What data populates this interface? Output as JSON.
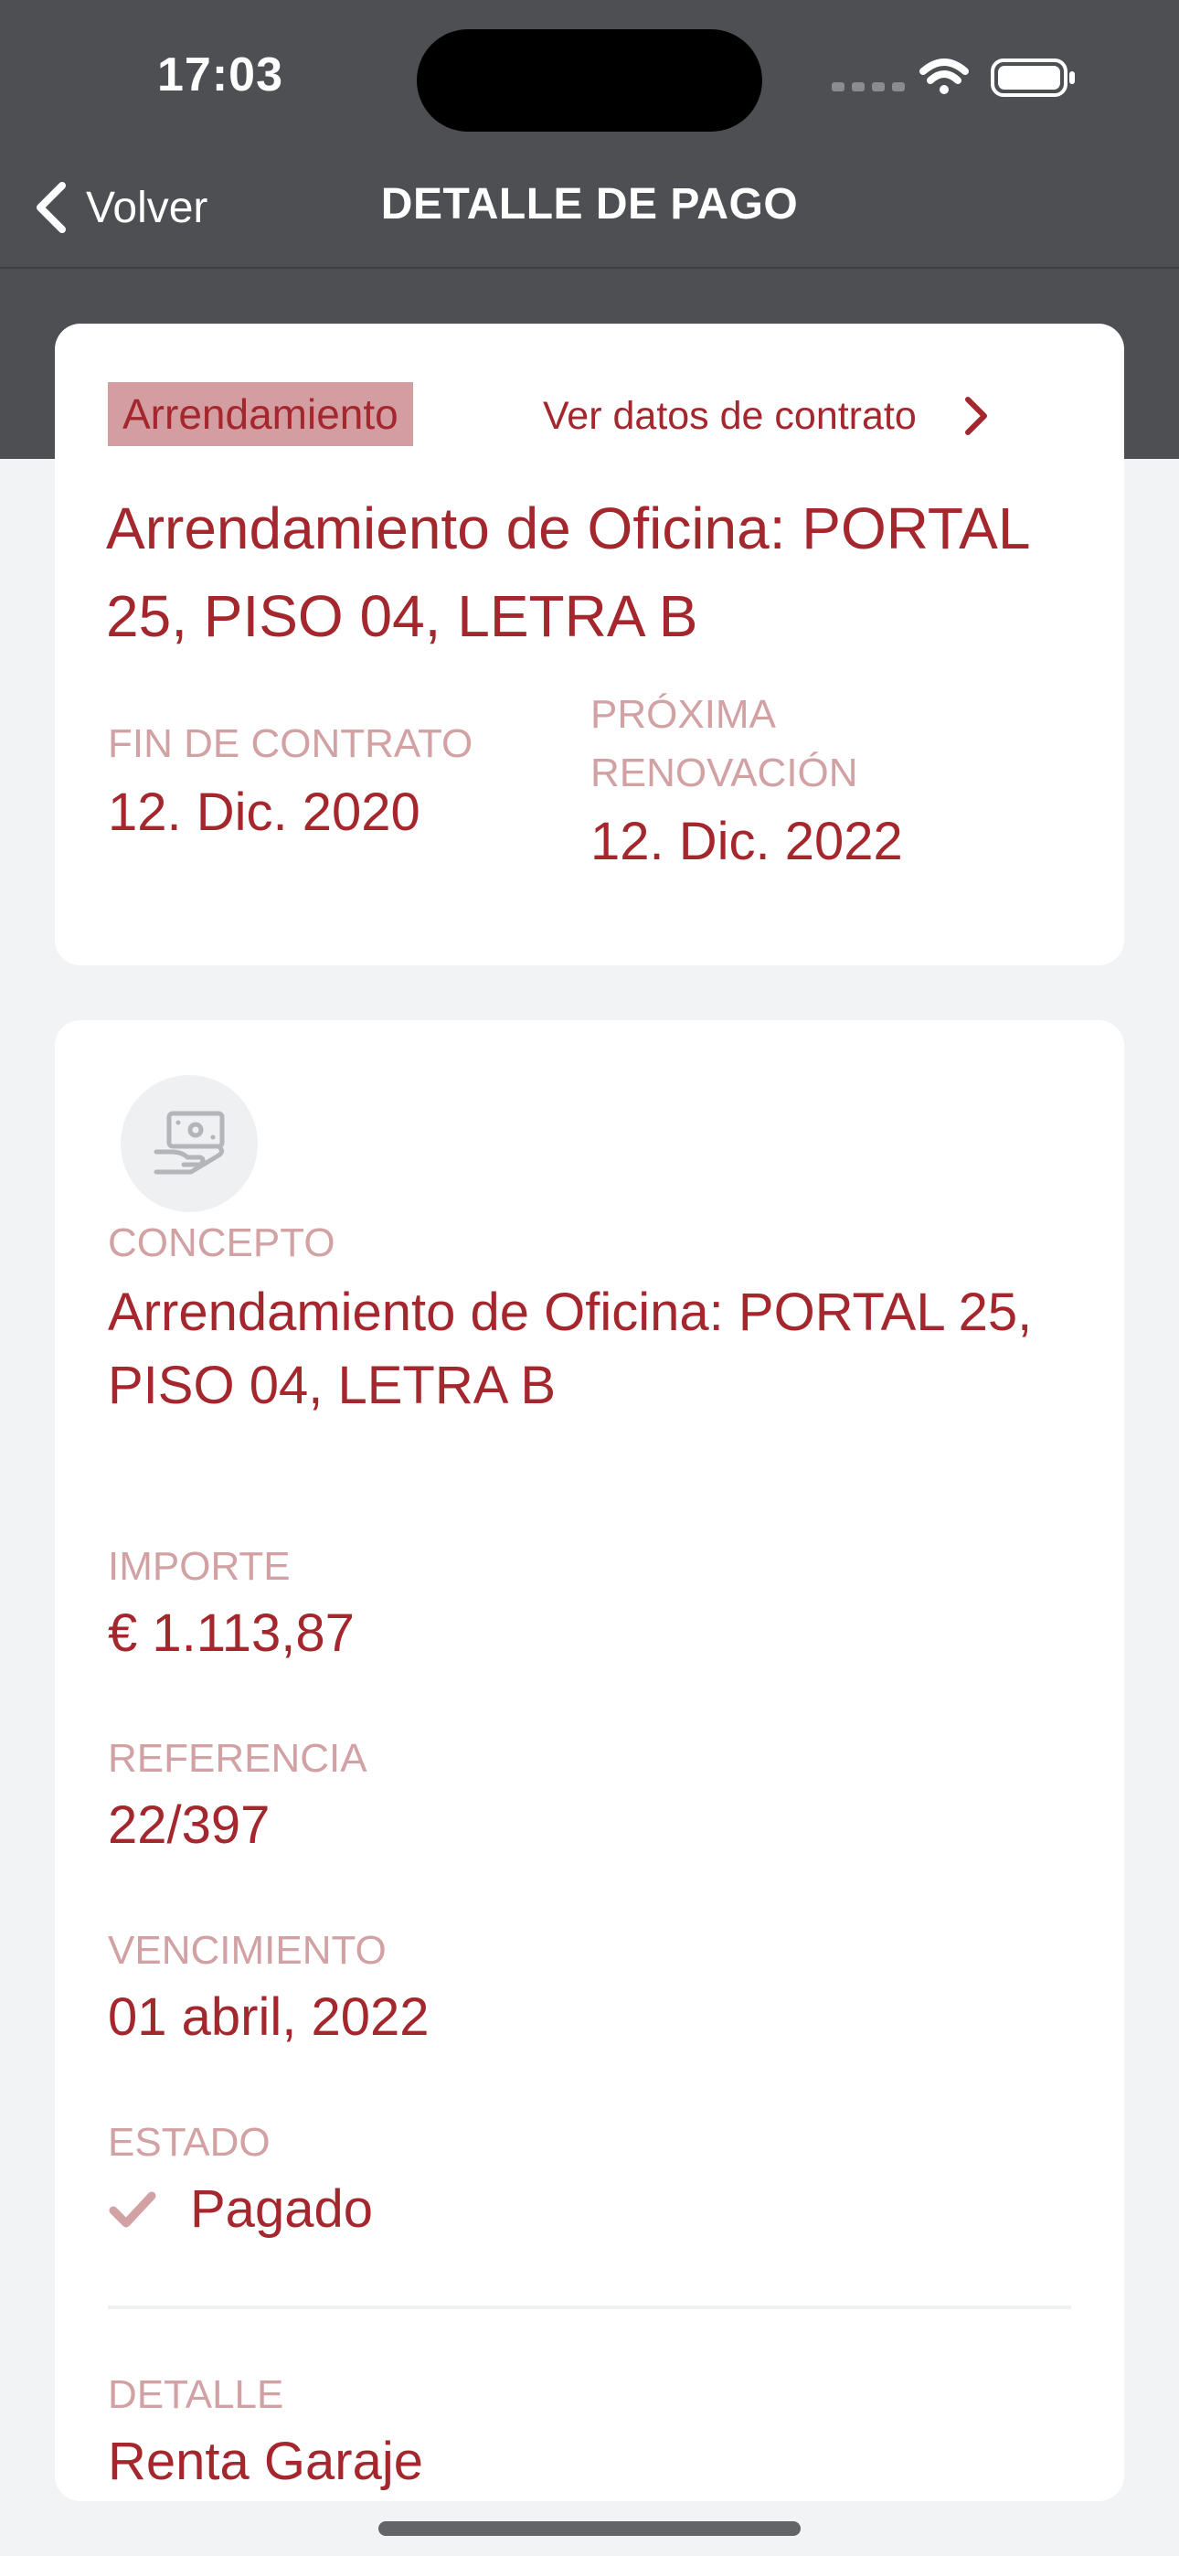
{
  "status_bar": {
    "time": "17:03"
  },
  "nav": {
    "back_label": "Volver",
    "title": "DETALLE DE PAGO"
  },
  "contract": {
    "tag": "Arrendamiento",
    "link_label": "Ver datos de contrato",
    "title": "Arrendamiento de Oficina: PORTAL 25, PISO 04, LETRA B",
    "end_label": "FIN DE CONTRATO",
    "end_value": "12. Dic. 2020",
    "renewal_label": "PRÓXIMA RENOVACIÓN",
    "renewal_value": "12. Dic. 2022"
  },
  "payment": {
    "concept_label": "CONCEPTO",
    "concept_value": "Arrendamiento de Oficina: PORTAL 25, PISO 04, LETRA B",
    "amount_label": "IMPORTE",
    "amount_value": "€ 1.113,87",
    "reference_label": "REFERENCIA",
    "reference_value": "22/397",
    "due_label": "VENCIMIENTO",
    "due_value": "01 abril, 2022",
    "status_label": "ESTADO",
    "status_value": "Pagado",
    "detail_label": "DETALLE",
    "detail_value": "Renta Garaje"
  },
  "icons": {
    "back": "chevron-left-icon",
    "link": "chevron-right-icon",
    "payment": "hand-money-icon",
    "status": "checkmark-icon",
    "wifi": "wifi-icon",
    "battery": "battery-icon",
    "signal": "cellular-signal-icon"
  },
  "colors": {
    "header": "#4d4f53",
    "accent": "#a3272d",
    "label": "#d2a1a4",
    "tag_bg": "#d49da1",
    "background": "#f2f3f5",
    "card": "#ffffff"
  }
}
